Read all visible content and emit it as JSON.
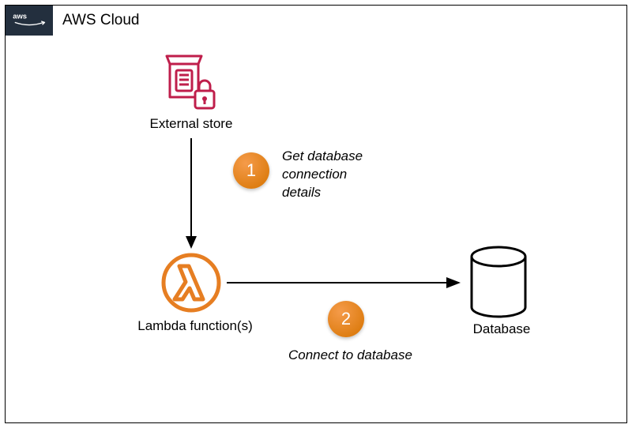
{
  "title": "AWS Cloud",
  "nodes": {
    "store": {
      "label": "External store"
    },
    "lambda": {
      "label": "Lambda function(s)"
    },
    "database": {
      "label": "Database"
    }
  },
  "steps": [
    {
      "num": "1",
      "text": "Get database\nconnection\ndetails"
    },
    {
      "num": "2",
      "text": "Connect to database"
    }
  ],
  "colors": {
    "store": "#bf1e4b",
    "lambda": "#e67e22",
    "badge": "#e67e22",
    "awsbox": "#232f3e"
  }
}
